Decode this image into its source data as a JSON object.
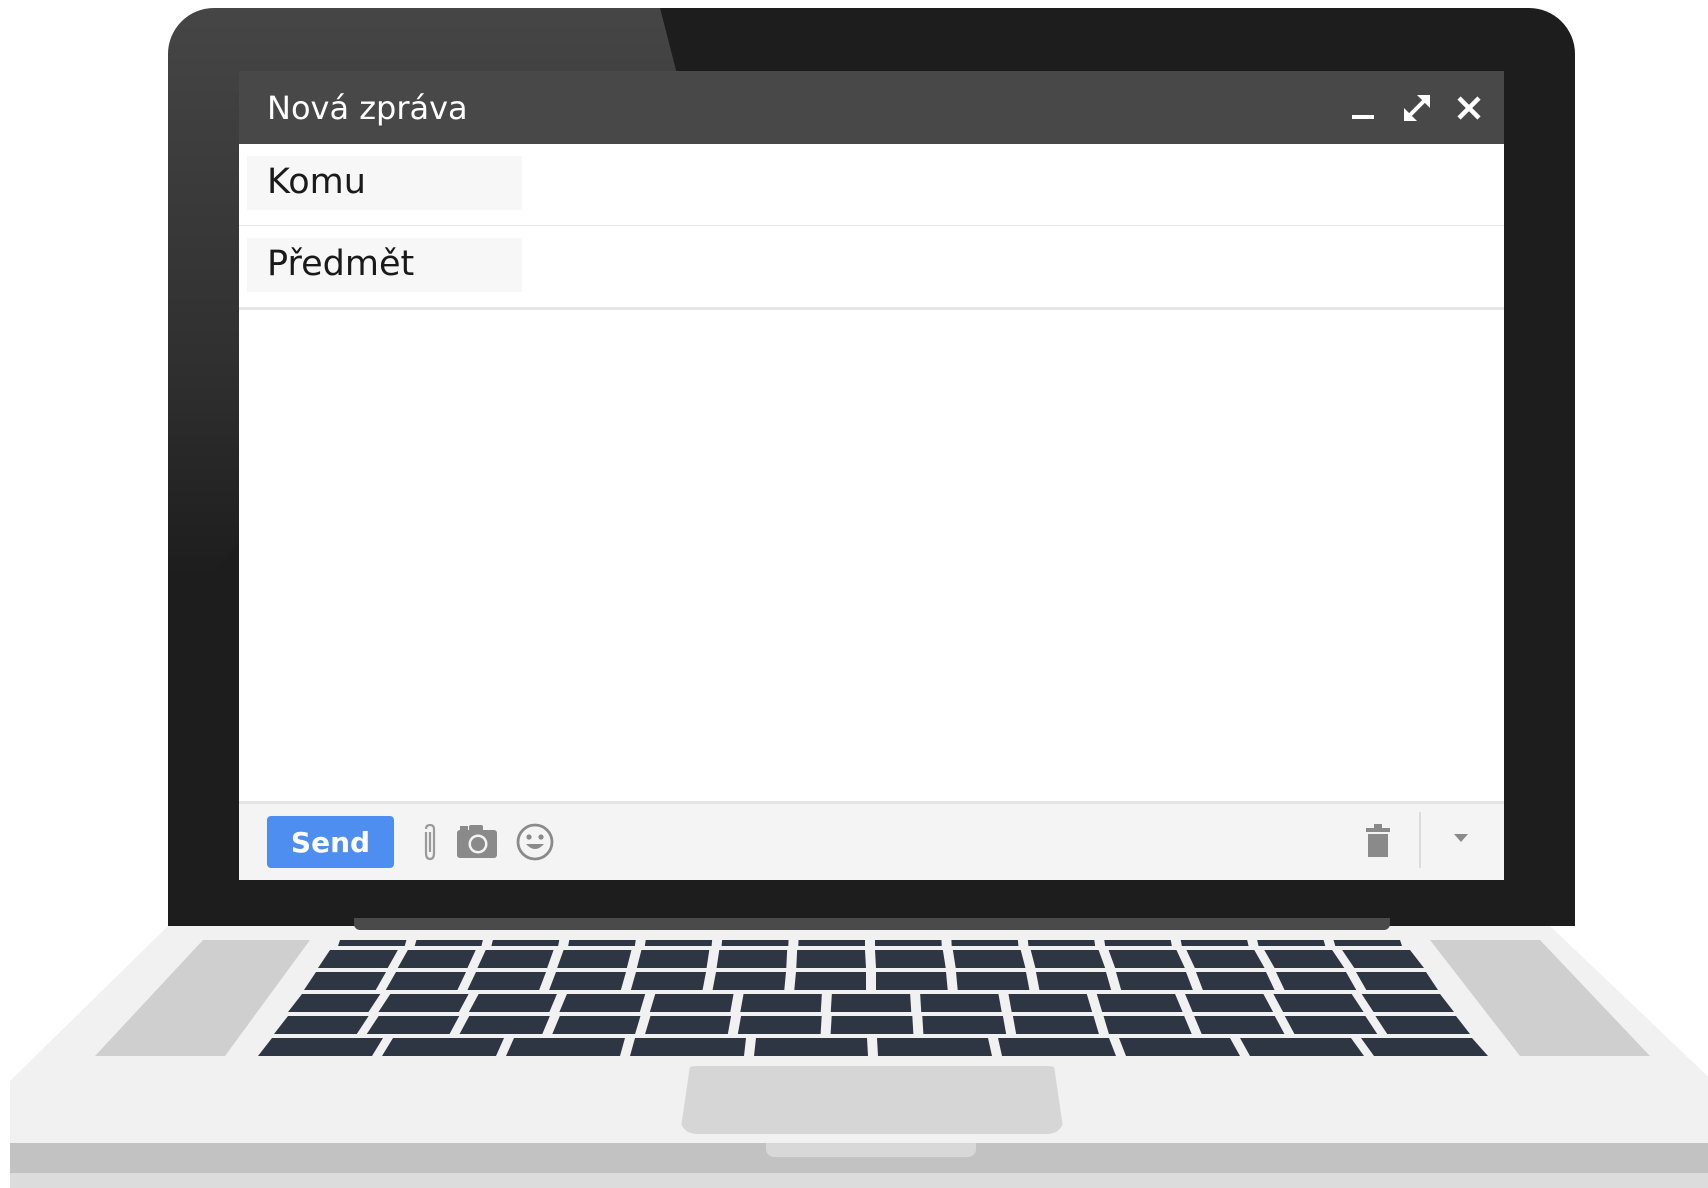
{
  "compose": {
    "title": "Nová zpráva",
    "to_label": "Komu",
    "to_value": "",
    "subject_label": "Předmět",
    "subject_value": "",
    "body_value": ""
  },
  "window_controls": {
    "minimize_icon": "minimize-icon",
    "expand_icon": "expand-icon",
    "close_icon": "close-icon"
  },
  "toolbar": {
    "send_label": "Send",
    "send_color": "#4d8ef0",
    "icons": [
      "attach-icon",
      "camera-icon",
      "emoji-icon",
      "trash-icon",
      "dropdown-arrow-icon"
    ]
  },
  "colors": {
    "titlebar": "#484848",
    "laptop_bezel": "#1d1d1d",
    "keycap": "#2e3543"
  }
}
